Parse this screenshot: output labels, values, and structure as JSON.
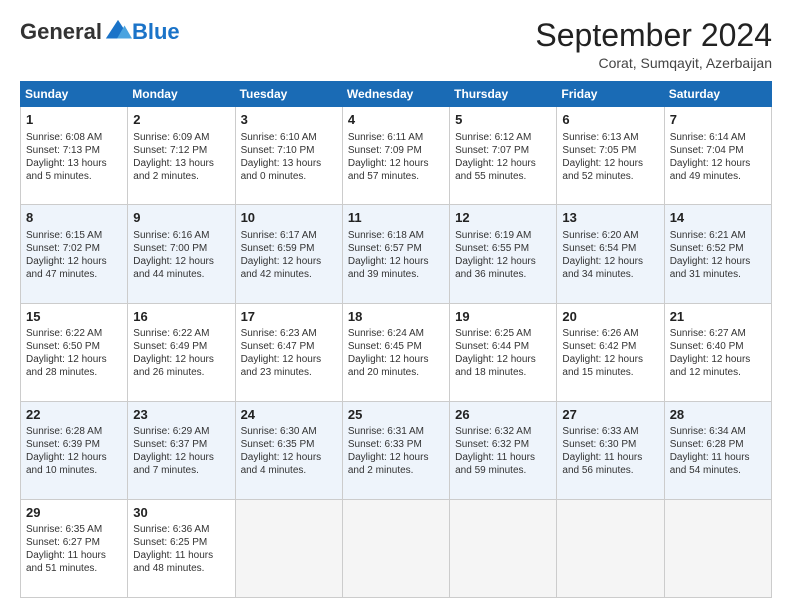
{
  "header": {
    "logo_general": "General",
    "logo_blue": "Blue",
    "month_title": "September 2024",
    "location": "Corat, Sumqayit, Azerbaijan"
  },
  "calendar": {
    "days_of_week": [
      "Sunday",
      "Monday",
      "Tuesday",
      "Wednesday",
      "Thursday",
      "Friday",
      "Saturday"
    ],
    "weeks": [
      [
        {
          "day": "1",
          "info": "Sunrise: 6:08 AM\nSunset: 7:13 PM\nDaylight: 13 hours\nand 5 minutes."
        },
        {
          "day": "2",
          "info": "Sunrise: 6:09 AM\nSunset: 7:12 PM\nDaylight: 13 hours\nand 2 minutes."
        },
        {
          "day": "3",
          "info": "Sunrise: 6:10 AM\nSunset: 7:10 PM\nDaylight: 13 hours\nand 0 minutes."
        },
        {
          "day": "4",
          "info": "Sunrise: 6:11 AM\nSunset: 7:09 PM\nDaylight: 12 hours\nand 57 minutes."
        },
        {
          "day": "5",
          "info": "Sunrise: 6:12 AM\nSunset: 7:07 PM\nDaylight: 12 hours\nand 55 minutes."
        },
        {
          "day": "6",
          "info": "Sunrise: 6:13 AM\nSunset: 7:05 PM\nDaylight: 12 hours\nand 52 minutes."
        },
        {
          "day": "7",
          "info": "Sunrise: 6:14 AM\nSunset: 7:04 PM\nDaylight: 12 hours\nand 49 minutes."
        }
      ],
      [
        {
          "day": "8",
          "info": "Sunrise: 6:15 AM\nSunset: 7:02 PM\nDaylight: 12 hours\nand 47 minutes."
        },
        {
          "day": "9",
          "info": "Sunrise: 6:16 AM\nSunset: 7:00 PM\nDaylight: 12 hours\nand 44 minutes."
        },
        {
          "day": "10",
          "info": "Sunrise: 6:17 AM\nSunset: 6:59 PM\nDaylight: 12 hours\nand 42 minutes."
        },
        {
          "day": "11",
          "info": "Sunrise: 6:18 AM\nSunset: 6:57 PM\nDaylight: 12 hours\nand 39 minutes."
        },
        {
          "day": "12",
          "info": "Sunrise: 6:19 AM\nSunset: 6:55 PM\nDaylight: 12 hours\nand 36 minutes."
        },
        {
          "day": "13",
          "info": "Sunrise: 6:20 AM\nSunset: 6:54 PM\nDaylight: 12 hours\nand 34 minutes."
        },
        {
          "day": "14",
          "info": "Sunrise: 6:21 AM\nSunset: 6:52 PM\nDaylight: 12 hours\nand 31 minutes."
        }
      ],
      [
        {
          "day": "15",
          "info": "Sunrise: 6:22 AM\nSunset: 6:50 PM\nDaylight: 12 hours\nand 28 minutes."
        },
        {
          "day": "16",
          "info": "Sunrise: 6:22 AM\nSunset: 6:49 PM\nDaylight: 12 hours\nand 26 minutes."
        },
        {
          "day": "17",
          "info": "Sunrise: 6:23 AM\nSunset: 6:47 PM\nDaylight: 12 hours\nand 23 minutes."
        },
        {
          "day": "18",
          "info": "Sunrise: 6:24 AM\nSunset: 6:45 PM\nDaylight: 12 hours\nand 20 minutes."
        },
        {
          "day": "19",
          "info": "Sunrise: 6:25 AM\nSunset: 6:44 PM\nDaylight: 12 hours\nand 18 minutes."
        },
        {
          "day": "20",
          "info": "Sunrise: 6:26 AM\nSunset: 6:42 PM\nDaylight: 12 hours\nand 15 minutes."
        },
        {
          "day": "21",
          "info": "Sunrise: 6:27 AM\nSunset: 6:40 PM\nDaylight: 12 hours\nand 12 minutes."
        }
      ],
      [
        {
          "day": "22",
          "info": "Sunrise: 6:28 AM\nSunset: 6:39 PM\nDaylight: 12 hours\nand 10 minutes."
        },
        {
          "day": "23",
          "info": "Sunrise: 6:29 AM\nSunset: 6:37 PM\nDaylight: 12 hours\nand 7 minutes."
        },
        {
          "day": "24",
          "info": "Sunrise: 6:30 AM\nSunset: 6:35 PM\nDaylight: 12 hours\nand 4 minutes."
        },
        {
          "day": "25",
          "info": "Sunrise: 6:31 AM\nSunset: 6:33 PM\nDaylight: 12 hours\nand 2 minutes."
        },
        {
          "day": "26",
          "info": "Sunrise: 6:32 AM\nSunset: 6:32 PM\nDaylight: 11 hours\nand 59 minutes."
        },
        {
          "day": "27",
          "info": "Sunrise: 6:33 AM\nSunset: 6:30 PM\nDaylight: 11 hours\nand 56 minutes."
        },
        {
          "day": "28",
          "info": "Sunrise: 6:34 AM\nSunset: 6:28 PM\nDaylight: 11 hours\nand 54 minutes."
        }
      ],
      [
        {
          "day": "29",
          "info": "Sunrise: 6:35 AM\nSunset: 6:27 PM\nDaylight: 11 hours\nand 51 minutes."
        },
        {
          "day": "30",
          "info": "Sunrise: 6:36 AM\nSunset: 6:25 PM\nDaylight: 11 hours\nand 48 minutes."
        },
        {
          "day": "",
          "info": ""
        },
        {
          "day": "",
          "info": ""
        },
        {
          "day": "",
          "info": ""
        },
        {
          "day": "",
          "info": ""
        },
        {
          "day": "",
          "info": ""
        }
      ]
    ]
  }
}
